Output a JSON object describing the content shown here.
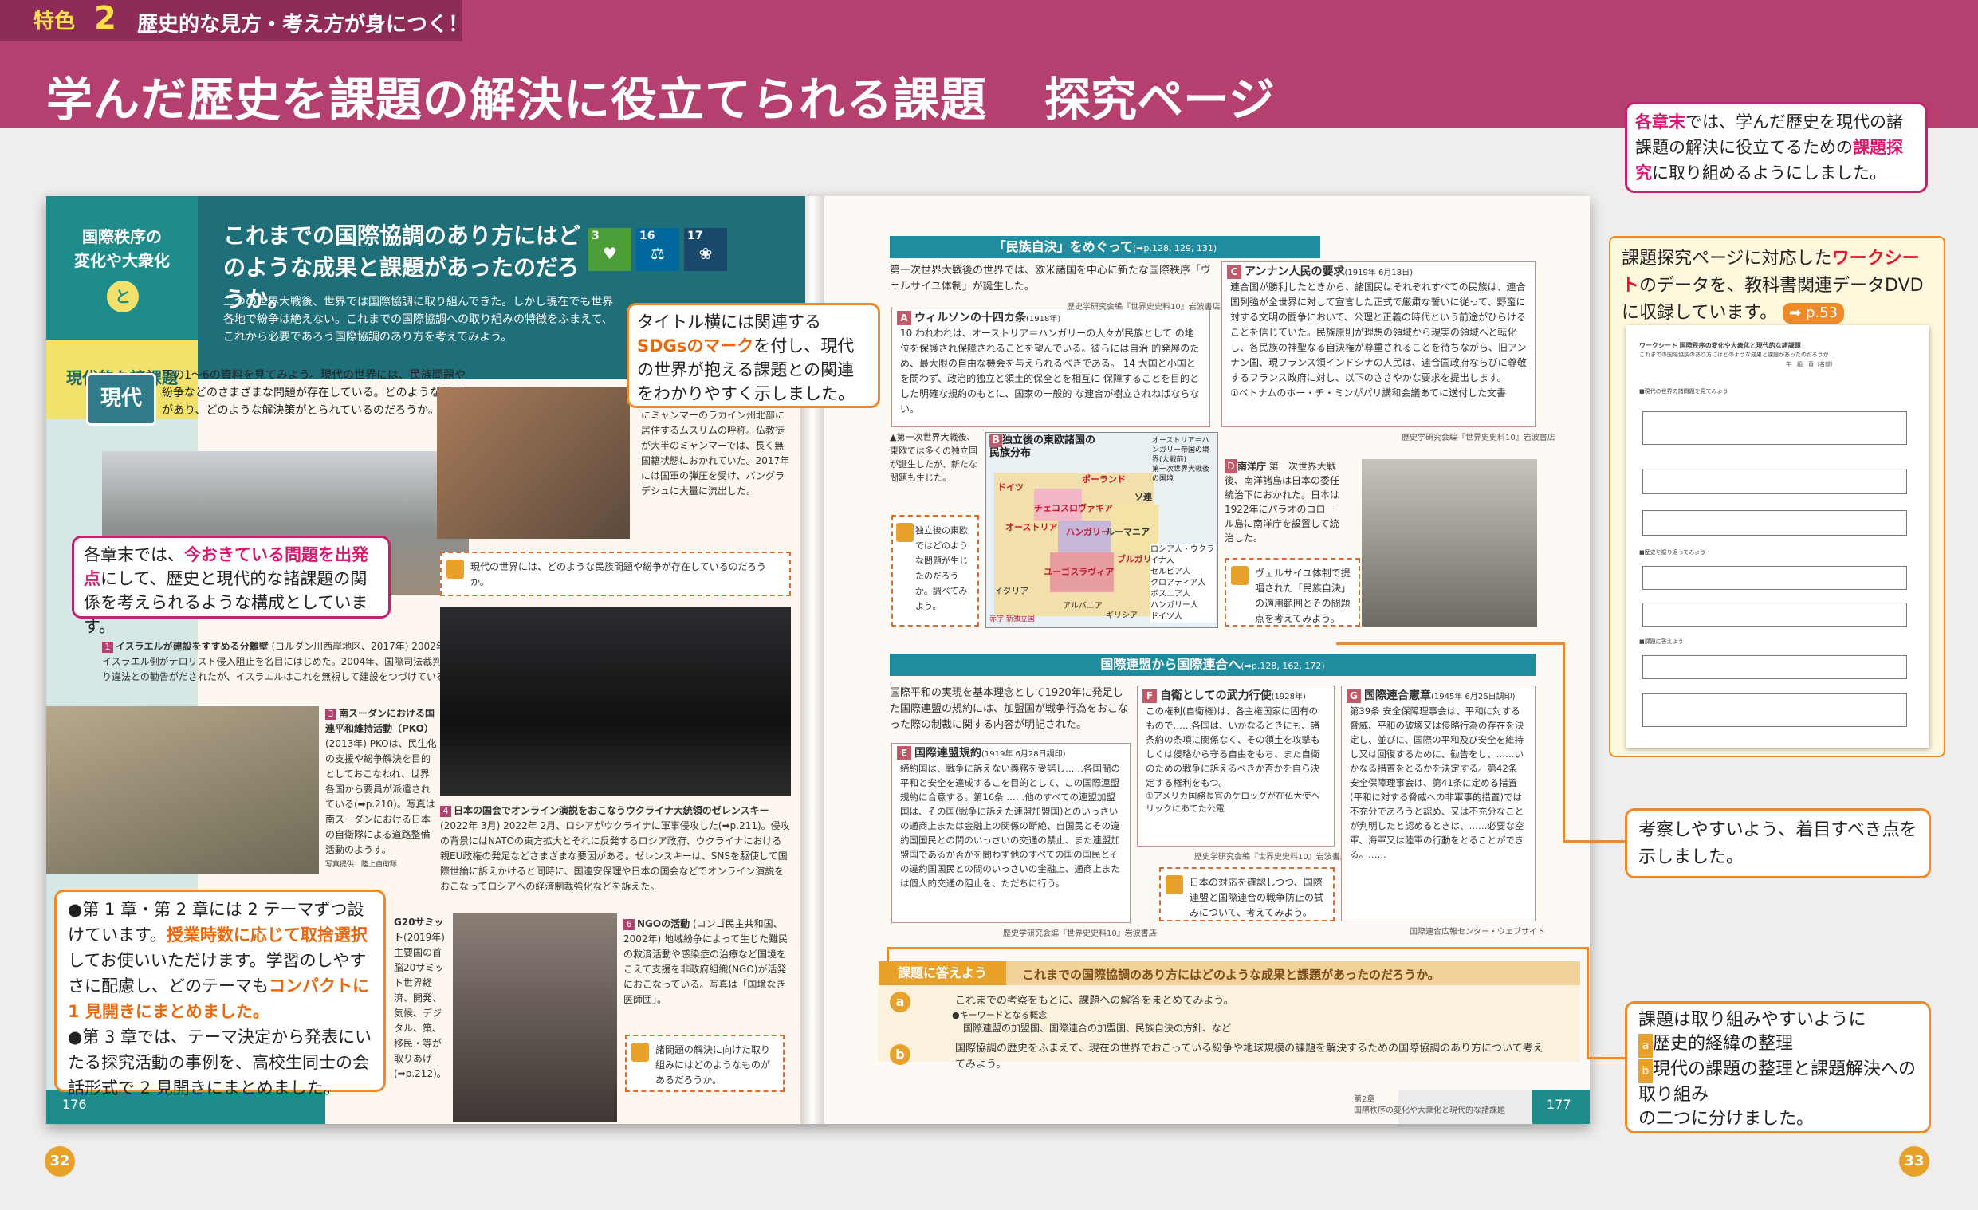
{
  "header": {
    "feature_label": "特色",
    "feature_number": "2",
    "feature_subtitle": "歴史的な見方・考え方が身につく！",
    "title": "学んだ歴史を課題の解決に役立てられる課題",
    "title_right": "探究ページ"
  },
  "callouts": {
    "top_right": {
      "prefix_hl": "各章末",
      "text1": "では、学んだ歴史を現代の諸課題の解決に役立てるための",
      "hl2": "課題探究",
      "text2": "に取り組めるようにしました。"
    },
    "worksheet": {
      "text1": "課題探究ページに対応した",
      "hl": "ワークシート",
      "text2": "のデータを、教科書関連データDVDに収録しています。",
      "ref": "➡ p.53"
    },
    "sdgs": {
      "text1": "タイトル横には関連する",
      "hl": "SDGsのマーク",
      "text2": "を付し、現代の世界が抱える課題との関連をわかりやすく示しました。"
    },
    "chapter_end": {
      "text1": "各章末では、",
      "hl": "今おきている問題を出発点",
      "text2": "にして、歴史と現代的な諸課題の関係を考えられるような構成としています。"
    },
    "bottom_left": {
      "bullet1_a": "●第 1 章・第 2 章には 2 テーマずつ設けています。",
      "bullet1_hl1": "授業時数に応じて取捨選択",
      "bullet1_b": "してお使いいただけます。学習のしやすさに配慮し、どのテーマも",
      "bullet1_hl2": "コンパクトに 1 見開きにまとめました。",
      "bullet2": "●第 3 章では、テーマ決定から発表にいたる探究活動の事例を、高校生同士の会話形式で 2 見開きにまとめました。"
    },
    "consider": {
      "text": "考察しやすいよう、着目すべき点を示しました。"
    },
    "task": {
      "line1": "課題は取り組みやすいように",
      "item_a": "歴史的経緯の整理",
      "item_b": "現代の課題の整理と課題解決への取り組み",
      "line_end": "の二つに分けました。"
    }
  },
  "left_page": {
    "topic_line1": "国際秩序の",
    "topic_line2": "変化や大衆化",
    "topic_circle": "と",
    "topic_sub": "現代的な諸課題",
    "lesson_title": "これまでの国際協調のあり方にはどのような成果と課題があったのだろうか。",
    "sdgs": [
      {
        "num": "3",
        "color": "#4c9f38"
      },
      {
        "num": "16",
        "color": "#00689d"
      },
      {
        "num": "17",
        "color": "#19486a"
      }
    ],
    "intro": "二つの世界大戦後、世界では国際協調に取り組んできた。しかし現在でも世界各地で紛争は絶えない。これまでの国際協調への取り組みの特徴をふまえて、これから必要であろう国際協調のあり方を考えてみよう。",
    "genndai_tab": "現代",
    "genndai_text": "下の1〜6の資料を見てみよう。現代の世界には、民族問題や紛争などのさまざまな問題が存在している。どのような問題があり、どのような解決策がとられているのだろうか。",
    "photo1_caption_title": "イスラエルが建設をすすめる分離壁",
    "photo1_caption": "(ヨルダン川西岸地区、2017年) 2002年以降、イスラエル側がテロリスト侵入阻止を名目にはじめた。2004年、国際司法裁判所により違法との勧告がだされたが、イスラエルはこれを無視して建設をつづけている。",
    "photo2_caption": "にミャンマーのラカイン州北部に居住するムスリムの呼称。仏教徒が大半のミャンマーでは、長く無国籍状態におかれていた。2017年には国軍の弾圧を受け、バングラデシュに大量に流出した。",
    "question1": "現代の世界には、どのような民族問題や紛争が存在しているのだろうか。",
    "photo3_caption_title": "南スーダンにおける国連平和維持活動（PKO）",
    "photo3_caption": "(2013年) PKOは、民生化の支援や紛争解決を目的としておこなわれ、世界各国から要員が派遣されている(➡p.210)。写真は南スーダンにおける日本の自衛隊による道路整備活動のようす。",
    "photo3_credit": "写真提供：陸上自衛隊",
    "photo4_caption_title": "日本の国会でオンライン演説をおこなうウクライナ大統領のゼレンスキー",
    "photo4_caption": "(2022年 3月) 2022年 2月、ロシアがウクライナに軍事侵攻した(➡p.211)。侵攻の背景にはNATOの東方拡大とそれに反発するロシア政府、ウクライナにおける親EU政権の発足などさまざまな要因がある。ゼレンスキーは、SNSを駆使して国際世論に訴えかけると同時に、国連安保理や日本の国会などでオンライン演説をおこなってロシアへの経済制裁強化などを訴えた。",
    "photo5_caption_title": "G20サミット",
    "photo5_caption": "(2019年) 主要国の首脳20サミット世界経済、開発、気候、デジタル、策、移民・等が取りあげ(➡p.212)。",
    "photo6_caption_title": "NGOの活動",
    "photo6_caption": "(コンゴ民主共和国、2002年) 地域紛争によって生じた難民の救済活動や感染症の治療など国境をこえて支援を非政府組織(NGO)が活発におこなっている。写真は「国境なき医師団」。",
    "question2": "諸問題の解決に向けた取り組みにはどのようなものがあるだろうか。",
    "page_number": "176"
  },
  "right_page": {
    "section1_title": "「民族自決」をめぐって",
    "section1_ref": "(➡p.128, 129, 131)",
    "section1_intro": "第一次世界大戦後の世界では、欧米諸国を中心に新たな国際秩序「ヴェルサイユ体制」が誕生した。",
    "doc_a_title": "ウィルソンの十四カ条",
    "doc_a_year": "(1918年)",
    "doc_a_credit": "歴史学研究会編『世界史史料10』岩波書店",
    "doc_a_text": "10 われわれは、オーストリア＝ハンガリーの人々が民族として の地位を保護され保障されることを望んでいる。彼らには自治 的発展のため、最大限の自由な機会を与えられるべきである。 14 大国と小国とを問わず、政治的独立と領土的保全とを相互に 保障することを目的とした明確な規約のもとに、国家の一般的 な連合が樹立されねばならない。",
    "doc_c_title": "アンナン人民の要求",
    "doc_c_year": "(1919年 6月18日)",
    "doc_c_text": "連合国が勝利したときから、諸国民はそれぞれすべての民族は、連合国列強が全世界に対して宣言した正式で厳粛な誓いに従って、野蛮に対する文明の闘争において、公理と正義の時代という前途がひらけることを信じていた。民族原則が理想の領域から現実の領域へと転化し、各民族の神聖なる自決権が尊重されることを待ちながら、旧アンナン国、現フランス領インドシナの人民は、連合国政府ならびに尊敬するフランス政府に対し、以下のささやかな要求を提出します。",
    "doc_c_signature": "①ベトナムのホー・チ・ミンがパリ講和会議あてに送付した文書",
    "doc_c_credit": "歴史学研究会編『世界史史料10』岩波書店",
    "map_note": "▲第一次世界大戦後、東欧では多くの独立国が誕生したが、新たな問題も生じた。",
    "map_title": "独立後の東欧諸国の民族分布",
    "map_legend_top": [
      "オーストリア＝ハンガリー帝国の境界(大戦前)",
      "第一次世界大戦後の国境"
    ],
    "map_legend": [
      "ロシア人・ウクライナ人",
      "セルビア人",
      "クロアティア人",
      "ボスニア人",
      "ハンガリー人",
      "ドイツ人"
    ],
    "map_countries": [
      "ポーランド",
      "ドイツ",
      "チェコスロヴァキア",
      "オーストリア",
      "ハンガリー",
      "ルーマニア",
      "ユーゴスラヴィア",
      "ブルガリア",
      "イタリア",
      "アルバニア",
      "ソ連",
      "ギリシア"
    ],
    "map_legend_red": "赤字 新独立国",
    "q_map": "独立後の東欧ではどのような問題が生じたのだろうか。調べてみよう。",
    "doc_d_title": "南洋庁",
    "doc_d_text": "第一次世界大戦後、南洋諸島は日本の委任統治下におかれた。日本は1922年にパラオのコロール島に南洋庁を設置して統治した。",
    "q_d": "ヴェルサイユ体制で提唱された「民族自決」の適用範囲とその問題点を考えてみよう。",
    "section2_title": "国際連盟から国際連合へ",
    "section2_ref": "(➡p.128, 162, 172)",
    "section2_intro": "国際平和の実現を基本理念として1920年に発足した国際連盟の規約には、加盟国が戦争行為をおこなった際の制裁に関する内容が明記された。",
    "doc_e_title": "国際連盟規約",
    "doc_e_year": "(1919年 6月28日調印)",
    "doc_e_text": "締約国は、戦争に訴えない義務を受諾し……各国間の平和と安全を達成するこを目的として、この国際連盟規約に合意する。第16条 ……他のすべての連盟加盟国は、その国(戦争に訴えた連盟加盟国)とのいっさいの通商上または金融上の関係の断絶、自国民とその違約国国民との間のいっさいの交通の禁止、また連盟加盟国であるか否かを問わず他のすべての国の国民とその違約国国民との間のいっさいの金融上、通商上または個人的交通の阻止を、ただちに行う。",
    "doc_e_credit": "歴史学研究会編『世界史史料10』岩波書店",
    "doc_f_title": "自衛としての武力行使",
    "doc_f_year": "(1928年)",
    "doc_f_text": "この権利(自衛権)は、各主権国家に固有のもので……各国は、いかなるときにも、諸条約の条項に関係なく、その領土を攻撃もしくは侵略から守る自由をもち、また自衛のための戦争に訴えるべきか否かを自ら決定する権利をもつ。",
    "doc_f_note": "①アメリカ国務長官のケロッグが在仏大使ヘリックにあてた公電",
    "doc_f_credit": "歴史学研究会編『世界史史料10』岩波書店",
    "doc_g_title": "国際連合憲章",
    "doc_g_year": "(1945年 6月26日調印)",
    "doc_g_text": "第39条 安全保障理事会は、平和に対する脅威、平和の破壊又は侵略行為の存在を決定し、並びに、国際の平和及び安全を維持し又は回復するために、勧告をし、……いかなる措置をとるかを決定する。第42条 安全保障理事会は、第41条に定める措置(平和に対する脅威への非軍事的措置)では不充分であろうと認め、又は不充分なことが判明したと認めるときは、……必要な空軍、海軍又は陸軍の行動をとることができる。……",
    "doc_g_credit": "国際連合広報センター・ウェブサイト",
    "q_f": "日本の対応を確認しつつ、国際連盟と国際連合の戦争防止の試みについて、考えてみよう。",
    "answer_label": "課題に答えよう",
    "answer_question": "これまでの国際協調のあり方にはどのような成果と課題があったのだろうか。",
    "answer_a_label": "a",
    "answer_a": "これまでの考察をもとに、課題への解答をまとめてみよう。",
    "answer_a_keyword_label": "●キーワードとなる概念",
    "answer_a_keywords": "国際連盟の加盟国、国際連合の加盟国、民族自決の方針、など",
    "answer_b_label": "b",
    "answer_b": "国際協調の歴史をふまえて、現在の世界でおこっている紛争や地球規模の課題を解決するための国際協調のあり方について考えてみよう。",
    "footer_chapter": "第2章",
    "footer_title": "国際秩序の変化や大衆化と現代的な諸課題",
    "page_number": "177"
  },
  "worksheet_sheet": {
    "header": "ワークシート 国際秩序の変化や大衆化と現代的な諸課題",
    "subtitle": "これまでの国際協調のあり方にはどのような成果と課題があったのだろうか",
    "name_row": "年　組　番（名前）",
    "q1": "■現代の世界の諸問題を見てみよう",
    "q2": "■歴史を振り返ってみよう",
    "q3": "■課題に答えよう"
  },
  "page_numbers": {
    "left": "32",
    "right": "33"
  }
}
